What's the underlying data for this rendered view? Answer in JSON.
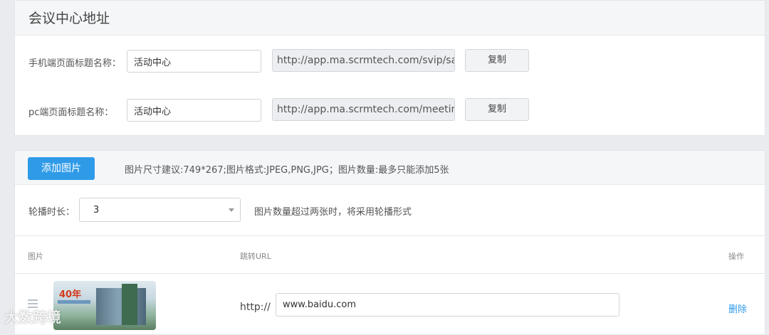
{
  "address_section": {
    "title": "会议中心地址",
    "mobile": {
      "label": "手机端页面标题名称：",
      "value": "活动中心",
      "url": "http://app.ma.scrmtech.com/svip/sapIn",
      "copy_label": "复制"
    },
    "pc": {
      "label": "pc端页面标题名称：",
      "value": "活动中心",
      "url": "http://app.ma.scrmtech.com/meetings/",
      "copy_label": "复制"
    }
  },
  "banner_section": {
    "add_button": "添加图片",
    "size_hint": "图片尺寸建议:749*267;图片格式:JPEG,PNG,JPG；图片数量:最多只能添加5张",
    "duration_label": "轮播时长：",
    "duration_value": "3",
    "duration_hint": "图片数量超过两张时，将采用轮播形式",
    "columns": {
      "image": "图片",
      "url": "跳转URL",
      "actions": "操作"
    },
    "rows": [
      {
        "thumb_text": "40年",
        "protocol": "http://",
        "url": "www.baidu.com",
        "delete_label": "删除"
      }
    ]
  },
  "watermark": "大数跨境",
  "colors": {
    "accent": "#2f9be8",
    "page_bg": "#e9ebee"
  }
}
